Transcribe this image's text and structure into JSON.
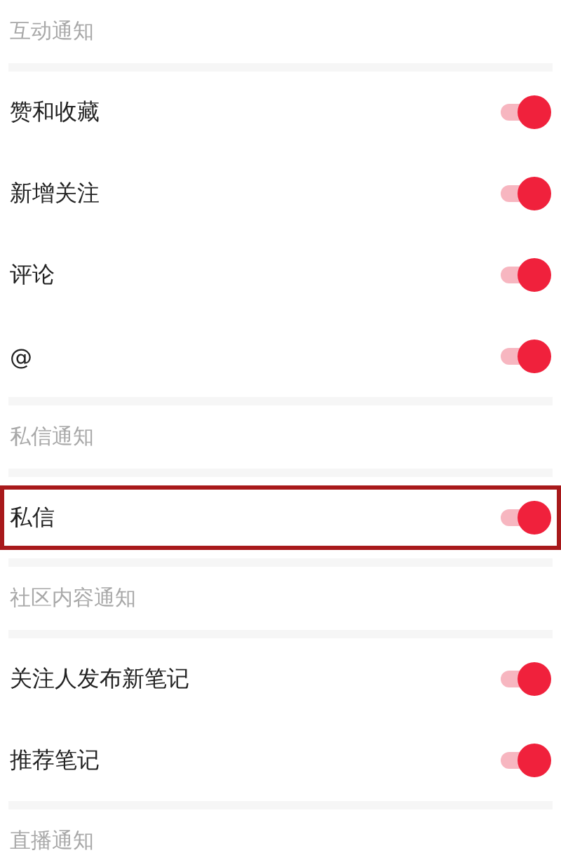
{
  "sections": [
    {
      "title": "互动通知",
      "items": [
        {
          "label": "赞和收藏",
          "on": true,
          "highlighted": false
        },
        {
          "label": "新增关注",
          "on": true,
          "highlighted": false
        },
        {
          "label": "评论",
          "on": true,
          "highlighted": false
        },
        {
          "label": "@",
          "on": true,
          "highlighted": false
        }
      ]
    },
    {
      "title": "私信通知",
      "items": [
        {
          "label": "私信",
          "on": true,
          "highlighted": true
        }
      ]
    },
    {
      "title": "社区内容通知",
      "items": [
        {
          "label": "关注人发布新笔记",
          "on": true,
          "highlighted": false
        },
        {
          "label": "推荐笔记",
          "on": true,
          "highlighted": false
        }
      ]
    },
    {
      "title": "直播通知"
    }
  ]
}
